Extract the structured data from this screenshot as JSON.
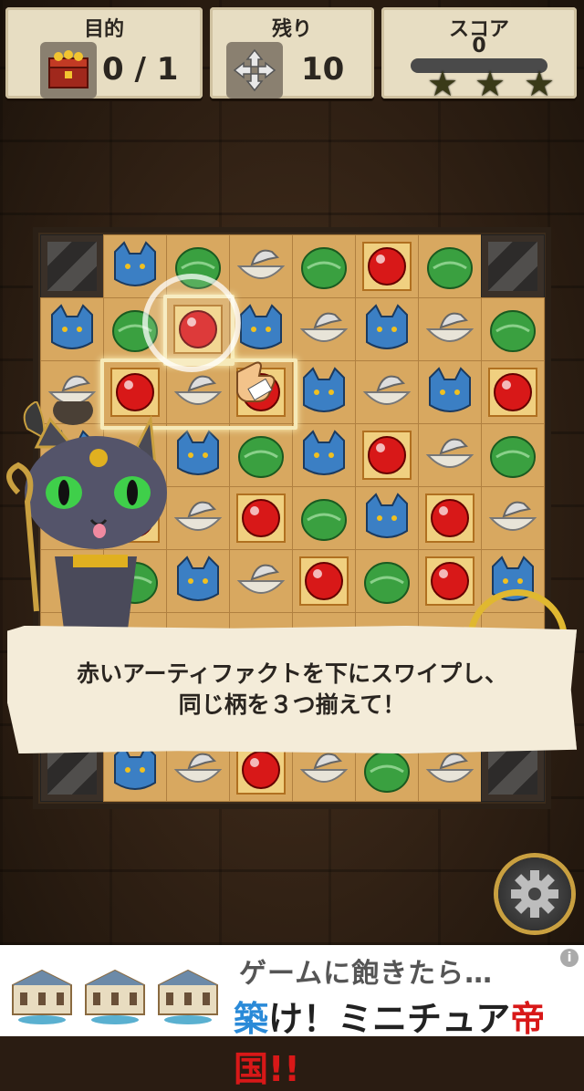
{
  "hud": {
    "goal_label": "目的",
    "goal_value": "0 / 1",
    "moves_label": "残り",
    "moves_value": "10",
    "score_label": "スコア",
    "score_value": "0",
    "stars_earned": 0,
    "stars_total": 3
  },
  "board": {
    "rows": 9,
    "cols": 8,
    "grid": [
      [
        "X",
        "C",
        "L",
        "B",
        "L",
        "R",
        "L",
        "X"
      ],
      [
        "C",
        "L",
        "R",
        "C",
        "B",
        "C",
        "B",
        "L"
      ],
      [
        "B",
        "R",
        "B",
        "R",
        "C",
        "B",
        "C",
        "R"
      ],
      [
        "C",
        "-",
        "C",
        "L",
        "C",
        "R",
        "B",
        "L"
      ],
      [
        "-",
        "R",
        "B",
        "R",
        "L",
        "C",
        "R",
        "B"
      ],
      [
        "-",
        "L",
        "C",
        "B",
        "R",
        "L",
        "R",
        "C"
      ],
      [
        "-",
        "-",
        "-",
        "-",
        "-",
        "-",
        "-",
        "-"
      ],
      [
        "-",
        "-",
        "-",
        "-",
        "-",
        "-",
        "-",
        "-"
      ],
      [
        "X",
        "C",
        "B",
        "R",
        "B",
        "L",
        "B",
        "X"
      ]
    ],
    "piece_colors": {
      "C": "#3b7fc4",
      "L": "#3aa040",
      "R": "#d81818",
      "B": "#e8e4d8"
    }
  },
  "tutorial": {
    "line1": "赤いアーティファクトを下にスワイプし、",
    "line2": "同じ柄を３つ揃えて！"
  },
  "ad": {
    "headline": "ゲームに飽きたら…",
    "brand_part1": "築",
    "brand_part2": "け！ミニチュア",
    "brand_part3": "帝国",
    "brand_part4": "!!",
    "info": "i"
  }
}
